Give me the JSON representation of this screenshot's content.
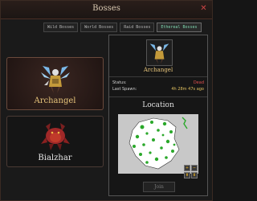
{
  "window": {
    "title": "Bosses",
    "close_icon": "close-icon"
  },
  "tabs": [
    {
      "label": "Wild Bosses",
      "active": false
    },
    {
      "label": "World Bosses",
      "active": false
    },
    {
      "label": "Raid Bosses",
      "active": false
    },
    {
      "label": "Ethereal Bosses",
      "active": true
    }
  ],
  "boss_list": [
    {
      "name": "Archangel",
      "selected": true
    },
    {
      "name": "Bialzhar",
      "selected": false
    }
  ],
  "details": {
    "name": "Archangel",
    "status_label": "Status:",
    "status_value": "Dead",
    "spawn_label": "Last Spawn:",
    "spawn_value": "4h 28m 47s ago",
    "location_title": "Location",
    "join_label": "Join",
    "map_buttons": [
      "+",
      "−",
      "⬆",
      "⬇"
    ]
  },
  "colors": {
    "accent_gold": "#e6c47a",
    "status_dead": "#e05050",
    "active_tab": "#7fd8b0"
  }
}
